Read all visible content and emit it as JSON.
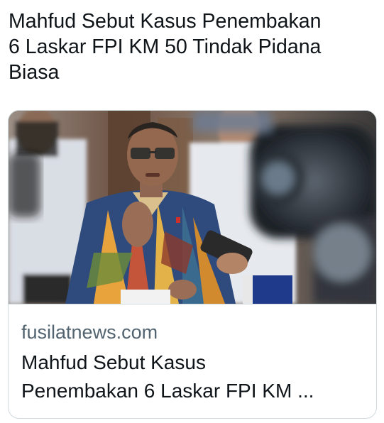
{
  "tweet": {
    "text_lines": [
      "Mahfud Sebut Kasus Penembakan",
      "6 Laskar FPI KM 50 Tindak Pidana",
      "Biasa"
    ]
  },
  "card": {
    "domain": "fusilatnews.com",
    "title_lines": [
      "Mahfud Sebut Kasus",
      "Penembakan 6 Laskar FPI KM ..."
    ],
    "image_alt": "Mahfud MD speaking to reporters surrounded by microphones"
  },
  "colors": {
    "text_primary": "#0f1419",
    "text_secondary": "#536471",
    "border": "#cfd9de",
    "background": "#ffffff"
  }
}
